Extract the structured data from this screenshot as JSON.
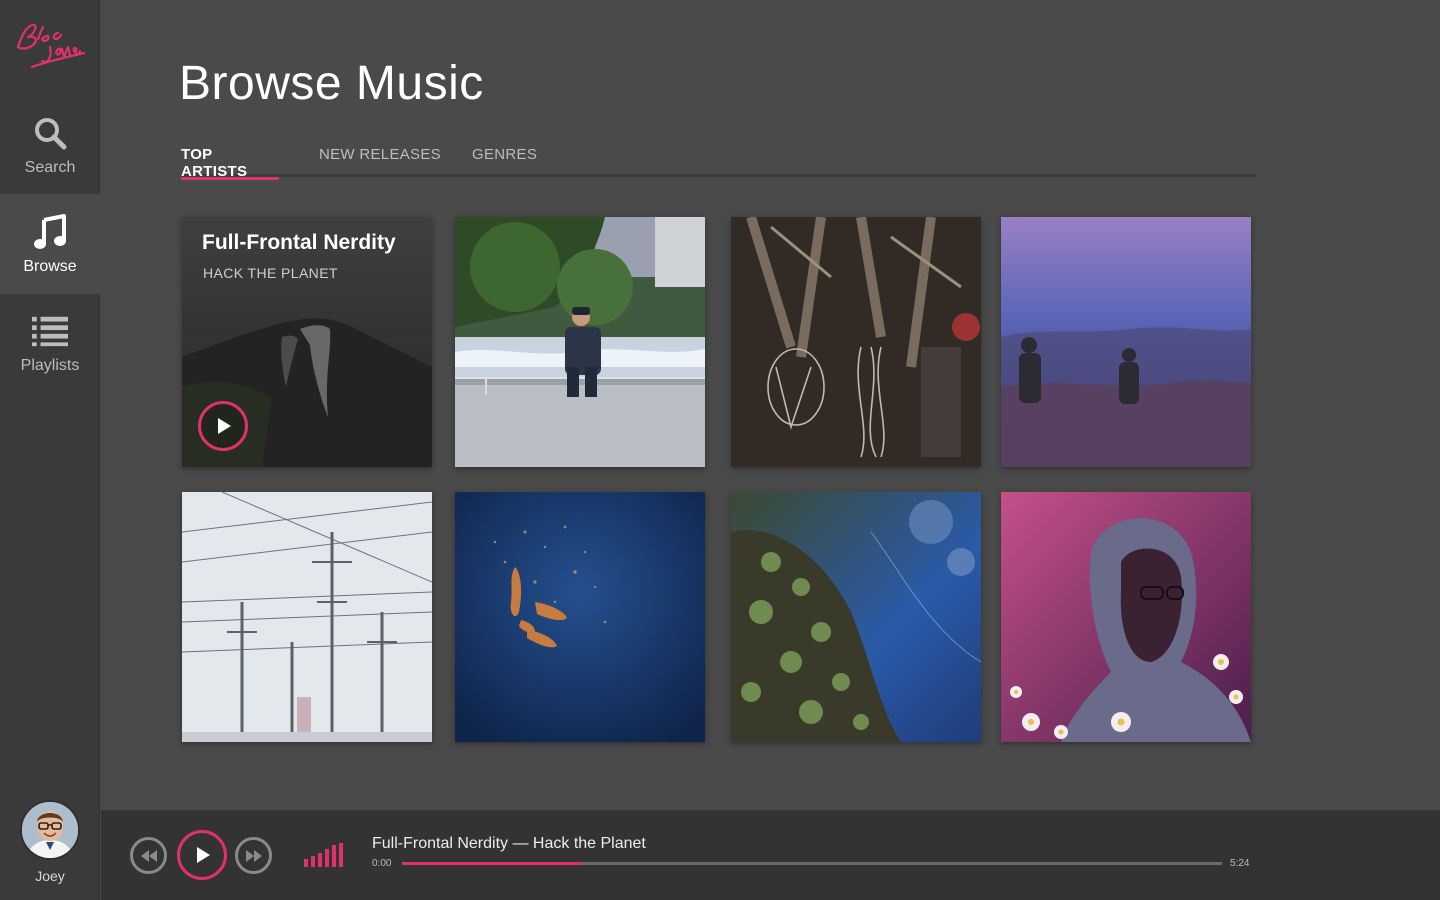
{
  "app": {
    "logo_text": "Bloc Jams",
    "accent_color": "#e0316e"
  },
  "sidebar": {
    "items": [
      {
        "label": "Search",
        "icon": "search-icon",
        "active": false
      },
      {
        "label": "Browse",
        "icon": "music-note-icon",
        "active": true
      },
      {
        "label": "Playlists",
        "icon": "list-icon",
        "active": false
      }
    ],
    "user": {
      "name": "Joey"
    }
  },
  "main": {
    "title": "Browse Music",
    "tabs": [
      {
        "label": "TOP ARTISTS",
        "active": true
      },
      {
        "label": "NEW RELEASES",
        "active": false
      },
      {
        "label": "GENRES",
        "active": false
      }
    ],
    "featured": {
      "title": "Full-Frontal Nerdity",
      "subtitle": "HACK THE PLANET"
    }
  },
  "player": {
    "now_playing": "Full-Frontal Nerdity — Hack the Planet",
    "current_time": "0:00",
    "total_time": "5:24",
    "progress_fraction": 0.22
  }
}
